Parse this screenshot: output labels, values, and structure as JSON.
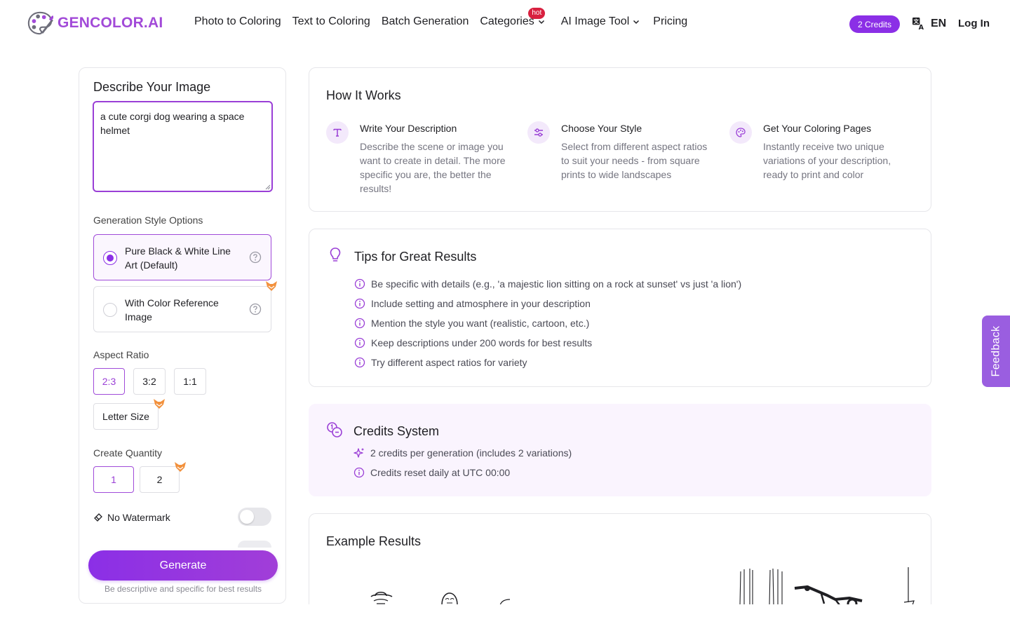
{
  "brand": {
    "name": "GENCOLOR.AI",
    "accent": "#8b2fe6"
  },
  "nav": {
    "items": [
      {
        "label": "Photo to Coloring"
      },
      {
        "label": "Text to Coloring"
      },
      {
        "label": "Batch Generation"
      },
      {
        "label": "Categories",
        "badge": "hot"
      },
      {
        "label": "AI Image Tool"
      },
      {
        "label": "Pricing"
      }
    ],
    "credits": "2 Credits",
    "language": "EN",
    "login": "Log In"
  },
  "form": {
    "title": "Describe Your Image",
    "description_value": "a cute corgi dog wearing a space helmet",
    "style_section": "Generation Style Options",
    "styles": [
      {
        "label": "Pure Black & White Line Art (Default)",
        "selected": true
      },
      {
        "label": "With Color Reference Image",
        "selected": false
      }
    ],
    "aspect_section": "Aspect Ratio",
    "aspect_ratios": [
      "2:3",
      "3:2",
      "1:1",
      "Letter Size"
    ],
    "aspect_selected": "2:3",
    "quantity_section": "Create Quantity",
    "quantities": [
      "1",
      "2"
    ],
    "quantity_selected": "1",
    "watermark_label": "No Watermark",
    "watermark_on": false,
    "generate_label": "Generate",
    "generate_hint": "Be descriptive and specific for best results"
  },
  "how_it_works": {
    "title": "How It Works",
    "steps": [
      {
        "icon": "text-icon",
        "title": "Write Your Description",
        "desc": "Describe the scene or image you want to create in detail. The more specific you are, the better the results!"
      },
      {
        "icon": "sliders-icon",
        "title": "Choose Your Style",
        "desc": "Select from different aspect ratios to suit your needs - from square prints to wide landscapes"
      },
      {
        "icon": "palette-icon",
        "title": "Get Your Coloring Pages",
        "desc": "Instantly receive two unique variations of your description, ready to print and color"
      }
    ]
  },
  "tips": {
    "title": "Tips for Great Results",
    "items": [
      "Be specific with details (e.g., 'a majestic lion sitting on a rock at sunset' vs just 'a lion')",
      "Include setting and atmosphere in your description",
      "Mention the style you want (realistic, cartoon, etc.)",
      "Keep descriptions under 200 words for best results",
      "Try different aspect ratios for variety"
    ]
  },
  "credits_system": {
    "title": "Credits System",
    "items": [
      "2 credits per generation (includes 2 variations)",
      "Credits reset daily at UTC 00:00"
    ]
  },
  "examples": {
    "title": "Example Results"
  },
  "feedback": {
    "label": "Feedback"
  }
}
